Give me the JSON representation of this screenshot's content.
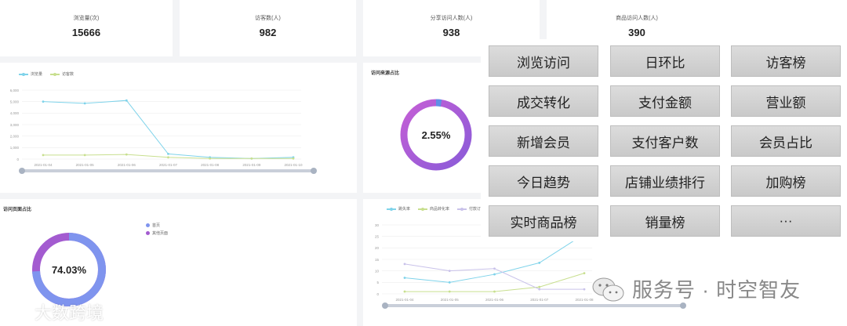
{
  "stats": [
    {
      "title": "浏览量(次)",
      "value": "15666"
    },
    {
      "title": "访客数(人)",
      "value": "982"
    },
    {
      "title": "分享访问人数(人)",
      "value": "938"
    },
    {
      "title": "商品访问人数(人)",
      "value": "390"
    }
  ],
  "trend_chart": {
    "legend": [
      "浏览量",
      "访客数"
    ],
    "colors": [
      "#7fd3ea",
      "#c8df8f"
    ],
    "y_ticks": [
      "6,000",
      "5,000",
      "4,000",
      "3,000",
      "2,000",
      "1,000",
      "0"
    ],
    "chart_data": {
      "type": "line",
      "categories": [
        "2021-01-04",
        "2021-01-05",
        "2021-01-06",
        "2021-01-07",
        "2021-01-08",
        "2021-01-09",
        "2021-01-10"
      ],
      "series": [
        {
          "name": "浏览量",
          "values": [
            5000,
            4850,
            5100,
            450,
            150,
            50,
            150
          ]
        },
        {
          "name": "访客数",
          "values": [
            350,
            350,
            400,
            150,
            50,
            50,
            50
          ]
        }
      ],
      "ylim": [
        0,
        6000
      ]
    }
  },
  "source_chart": {
    "title": "访问来源占比",
    "center_label": "2.55%",
    "percent": 2.55
  },
  "page_chart": {
    "title": "访问页面占比",
    "center_label": "74.03%",
    "percent": 74.03,
    "legend": [
      "首页",
      "其他页面"
    ],
    "colors": [
      "#7f94ee",
      "#a35bd0"
    ]
  },
  "conversion_chart": {
    "legend": [
      "跳失率",
      "商品转化率",
      "付款订单"
    ],
    "colors": [
      "#7fd3ea",
      "#c8df8f",
      "#c9c2ea"
    ],
    "y_ticks": [
      "30",
      "25",
      "20",
      "15",
      "10",
      "5",
      "0"
    ],
    "chart_data": {
      "type": "line",
      "categories": [
        "2021-01-04",
        "2021-01-05",
        "2021-01-06",
        "2021-01-07",
        "2021-01-08"
      ],
      "series": [
        {
          "name": "跳失率",
          "values": [
            7,
            5,
            8.5,
            13.5,
            26
          ]
        },
        {
          "name": "商品转化率",
          "values": [
            1,
            1,
            1,
            3,
            9
          ]
        },
        {
          "name": "付款订单",
          "values": [
            13,
            10,
            11,
            2,
            2
          ]
        }
      ],
      "ylim": [
        0,
        30
      ]
    }
  },
  "menu": {
    "items": [
      "浏览访问",
      "日环比",
      "访客榜",
      "成交转化",
      "支付金额",
      "营业额",
      "新增会员",
      "支付客户数",
      "会员占比",
      "今日趋势",
      "店铺业绩排行",
      "加购榜",
      "实时商品榜",
      "销量榜",
      "···"
    ]
  },
  "watermarks": {
    "left": "大数跨境",
    "right": "服务号 · 时空智友"
  }
}
